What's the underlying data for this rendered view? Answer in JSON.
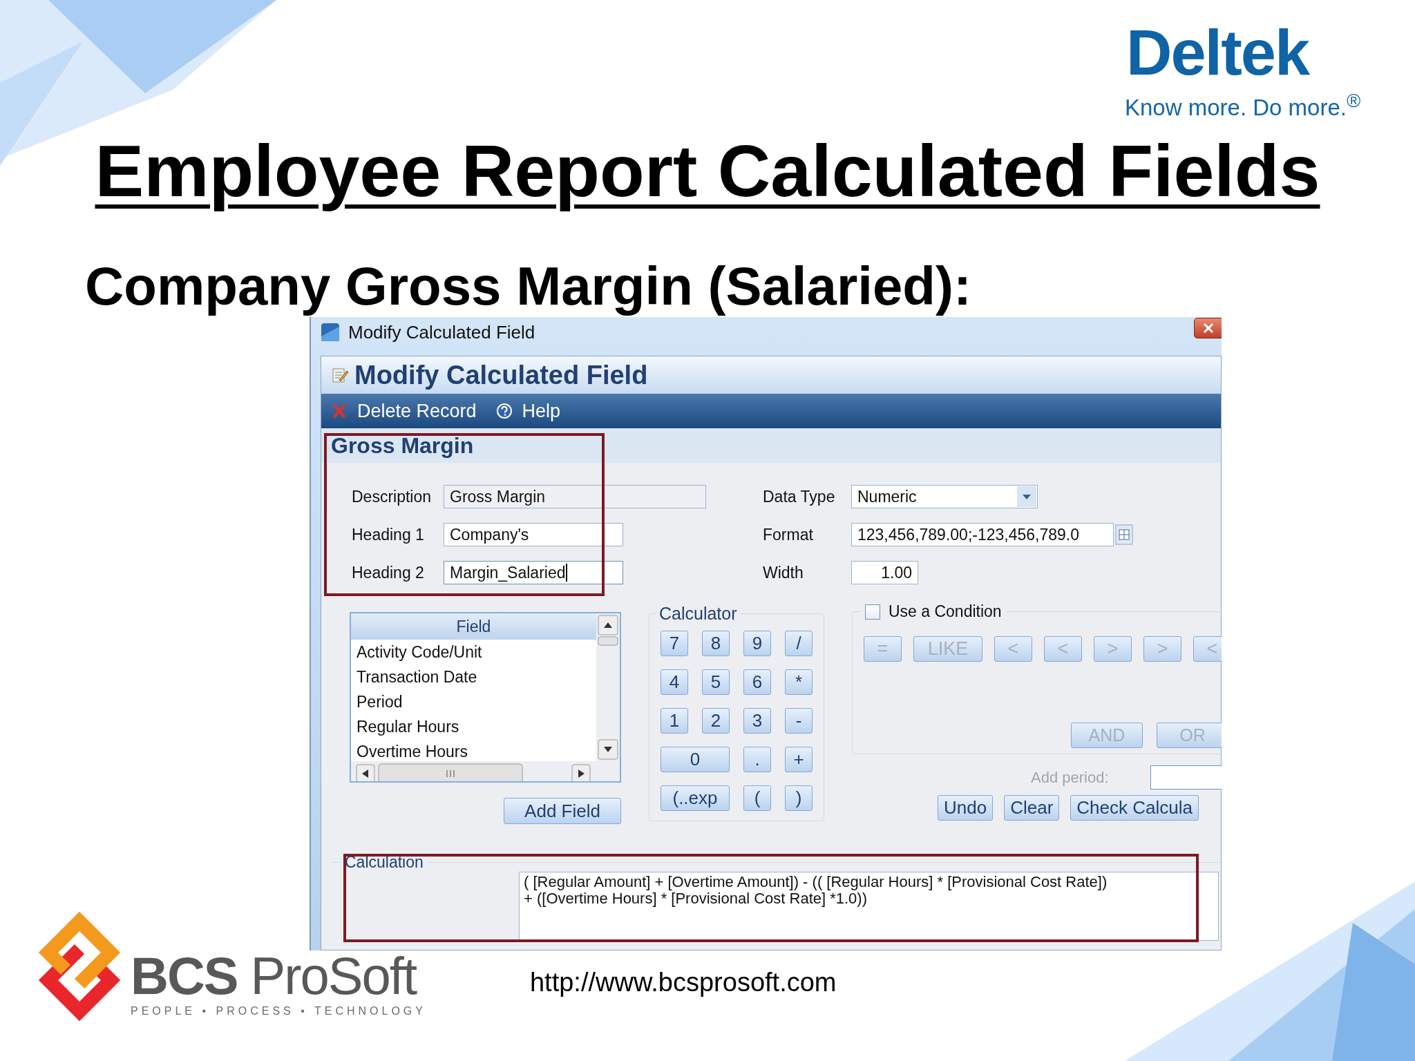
{
  "brand": {
    "name": "Deltek",
    "tagline": "Know more. Do more.$^{®}$"
  },
  "title": "Employee Report Calculated Fields",
  "subtitle": "Company Gross Margin (Salaried):",
  "window": {
    "title": "Modify Calculated Field",
    "header": "Modify Calculated Field",
    "toolbar": [
      {
        "label": "Delete Record",
        "kind": "delete"
      },
      {
        "label": "Help",
        "kind": "help"
      }
    ],
    "record_name": "Gross Margin",
    "left_fields": [
      {
        "label": "Description",
        "value": "Gross Margin",
        "kind": "readonly",
        "focused": false
      },
      {
        "label": "Heading 1",
        "value": "Company's",
        "kind": "text",
        "focused": false
      },
      {
        "label": "Heading 2",
        "value": "Margin_Salaried",
        "kind": "text",
        "focused": true
      }
    ],
    "right_fields": [
      {
        "label": "Data Type",
        "value": "Numeric",
        "kind": "dropdown"
      },
      {
        "label": "Format",
        "value": "123,456,789.00;-123,456,789.0",
        "kind": "picker"
      },
      {
        "label": "Width",
        "value": "1.00",
        "kind": "number"
      }
    ],
    "field_list": {
      "header": "Field",
      "items": [
        "Activity Code/Unit",
        "Transaction Date",
        "Period",
        "Regular Hours",
        "Overtime Hours"
      ]
    },
    "add_field_button": "Add Field",
    "calculator": {
      "title": "Calculator",
      "keys": [
        {
          "label": "7",
          "wide": false
        },
        {
          "label": "8",
          "wide": false
        },
        {
          "label": "9",
          "wide": false
        },
        {
          "label": "/",
          "wide": false
        },
        {
          "label": "4",
          "wide": false
        },
        {
          "label": "5",
          "wide": false
        },
        {
          "label": "6",
          "wide": false
        },
        {
          "label": "*",
          "wide": false
        },
        {
          "label": "1",
          "wide": false
        },
        {
          "label": "2",
          "wide": false
        },
        {
          "label": "3",
          "wide": false
        },
        {
          "label": "-",
          "wide": false
        },
        {
          "label": "0",
          "wide": true
        },
        {
          "label": ".",
          "wide": false
        },
        {
          "label": "+",
          "wide": false
        },
        {
          "label": "(..exp",
          "wide": true
        },
        {
          "label": "(",
          "wide": false
        },
        {
          "label": ")",
          "wide": false
        }
      ]
    },
    "condition": {
      "label": "Use a Condition",
      "checked": false,
      "operators": [
        {
          "label": "=",
          "disabled": true
        },
        {
          "label": "LIKE",
          "disabled": true
        },
        {
          "label": "<",
          "disabled": true
        },
        {
          "label": "<",
          "disabled": true
        },
        {
          "label": ">",
          "disabled": true
        },
        {
          "label": ">",
          "disabled": true
        },
        {
          "label": "<",
          "disabled": true
        }
      ],
      "logic": [
        {
          "label": "AND",
          "disabled": true
        },
        {
          "label": "OR",
          "disabled": true
        }
      ]
    },
    "add_period_label": "Add period:",
    "actions": [
      "Undo",
      "Clear",
      "Check Calcula"
    ],
    "calculation": {
      "label": "Calculation",
      "text": "( [Regular Amount] + [Overtime Amount]) - (( [Regular Hours] * [Provisional Cost Rate])\n+ ([Overtime Hours] * [Provisional Cost Rate] *1.0))"
    }
  },
  "footer": {
    "company": "**BCS** ProSoft",
    "tagline": "PEOPLE • PROCESS • TECHNOLOGY",
    "url": "http://www.bcsprosoft.com"
  }
}
